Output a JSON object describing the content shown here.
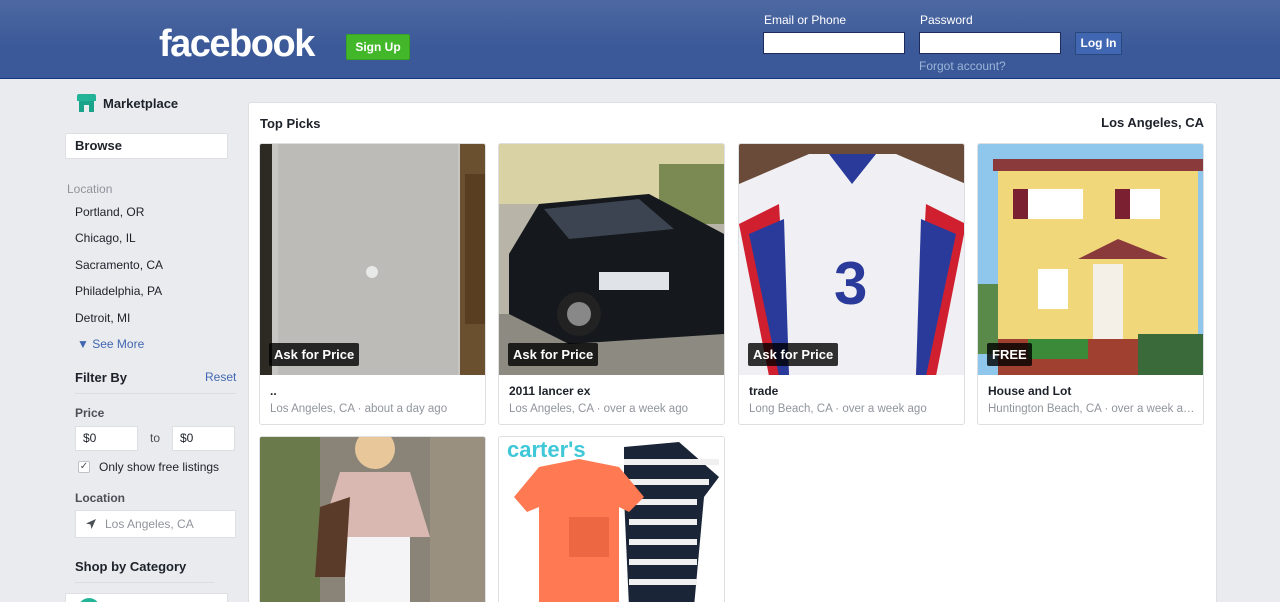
{
  "header": {
    "logo": "facebook",
    "signup_label": "Sign Up",
    "email_label": "Email or Phone",
    "email_value": "",
    "password_label": "Password",
    "password_value": "",
    "login_label": "Log In",
    "forgot_label": "Forgot account?"
  },
  "sidebar": {
    "title": "Marketplace",
    "browse_label": "Browse",
    "location_heading": "Location",
    "cities": [
      "Portland, OR",
      "Chicago, IL",
      "Sacramento, CA",
      "Philadelphia, PA",
      "Detroit, MI"
    ],
    "see_more": "See More",
    "filter_by": "Filter By",
    "reset": "Reset",
    "price_label": "Price",
    "price_min": "$0",
    "to_label": "to",
    "price_max": "$0",
    "free_only_label": "Only show free listings",
    "free_only_checked": true,
    "location_label": "Location",
    "location_placeholder": "Los Angeles, CA",
    "shop_by_category": "Shop by Category"
  },
  "main": {
    "heading": "Top Picks",
    "location": "Los Angeles, CA",
    "listings": [
      {
        "price": "Ask for Price",
        "title": "..",
        "meta": "Los Angeles, CA · about a day ago"
      },
      {
        "price": "Ask for Price",
        "title": "2011 lancer ex",
        "meta": "Los Angeles, CA · over a week ago"
      },
      {
        "price": "Ask for Price",
        "title": "trade",
        "meta": "Long Beach, CA · over a week ago"
      },
      {
        "price": "FREE",
        "title": "House and Lot",
        "meta": "Huntington Beach, CA · over a week ago"
      }
    ],
    "second_row": [
      {
        "logo_text": ""
      },
      {
        "logo_text": "carter's"
      }
    ]
  },
  "colors": {
    "header_blue": "#3b5998",
    "signup_green": "#42b72a",
    "link_blue": "#4267b2",
    "marketplace_teal": "#23b397"
  }
}
